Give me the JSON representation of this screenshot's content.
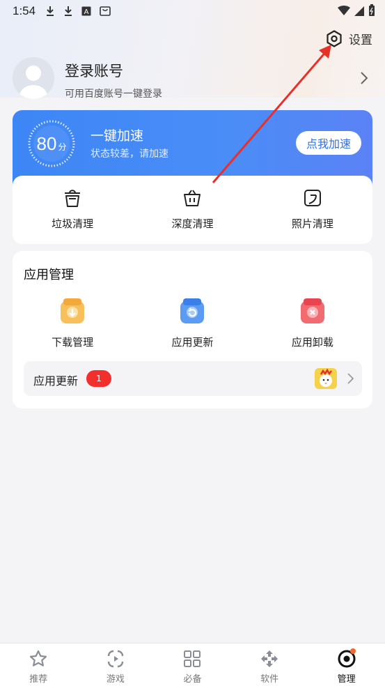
{
  "status_bar": {
    "time": "1:54"
  },
  "settings": {
    "label": "设置"
  },
  "profile": {
    "name": "登录账号",
    "subtitle": "可用百度账号一键登录"
  },
  "boost": {
    "score": "80",
    "score_unit": "分",
    "title": "一键加速",
    "subtitle": "状态较差，请加速",
    "button": "点我加速"
  },
  "clean": {
    "items": [
      {
        "label": "垃圾清理",
        "icon": "trash-bin-icon"
      },
      {
        "label": "深度清理",
        "icon": "basket-icon"
      },
      {
        "label": "照片清理",
        "icon": "photo-icon"
      }
    ]
  },
  "app_manage": {
    "title": "应用管理",
    "items": [
      {
        "label": "下载管理",
        "icon": "download-icon",
        "color": "#f8b940"
      },
      {
        "label": "应用更新",
        "icon": "update-icon",
        "color": "#4a8ff0"
      },
      {
        "label": "应用卸载",
        "icon": "uninstall-icon",
        "color": "#ef4e56"
      }
    ],
    "update_row": {
      "label": "应用更新",
      "badge": "1"
    }
  },
  "tabbar": {
    "tabs": [
      {
        "label": "推荐",
        "icon": "star-icon",
        "active": false
      },
      {
        "label": "游戏",
        "icon": "game-icon",
        "active": false
      },
      {
        "label": "必备",
        "icon": "grid-icon",
        "active": false
      },
      {
        "label": "软件",
        "icon": "software-icon",
        "active": false
      },
      {
        "label": "管理",
        "icon": "manage-icon",
        "active": true
      }
    ]
  },
  "colors": {
    "accent": "#3d86f6",
    "badge": "#f12f2c",
    "annotation_arrow": "#e8302a"
  }
}
